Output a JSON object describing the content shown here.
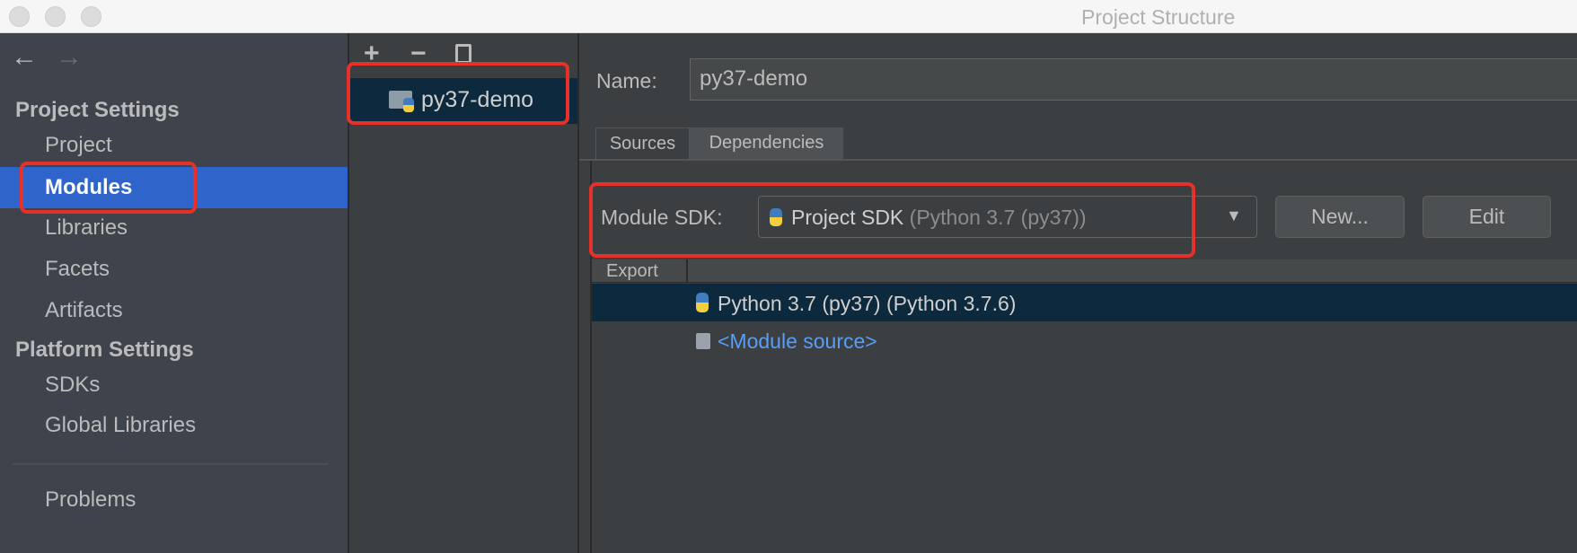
{
  "window": {
    "title": "Project Structure"
  },
  "sidebar": {
    "project_settings": "Project Settings",
    "items": [
      {
        "label": "Project"
      },
      {
        "label": "Modules"
      },
      {
        "label": "Libraries"
      },
      {
        "label": "Facets"
      },
      {
        "label": "Artifacts"
      }
    ],
    "platform_settings": "Platform Settings",
    "platform_items": [
      {
        "label": "SDKs"
      },
      {
        "label": "Global Libraries"
      }
    ],
    "problems": "Problems",
    "selected": "Modules"
  },
  "modules": {
    "items": [
      {
        "label": "py37-demo"
      }
    ]
  },
  "detail": {
    "name_label": "Name:",
    "name_value": "py37-demo",
    "tabs": [
      {
        "label": "Sources"
      },
      {
        "label": "Dependencies"
      }
    ],
    "active_tab": "Dependencies",
    "sdk_label": "Module SDK:",
    "sdk_value": "Project SDK",
    "sdk_detail": "(Python 3.7 (py37))",
    "new_button": "New...",
    "edit_button": "Edit",
    "table": {
      "header": "Export",
      "rows": [
        {
          "label": "Python 3.7 (py37) (Python 3.7.6)"
        },
        {
          "label": "<Module source>"
        }
      ]
    }
  },
  "colors": {
    "selection": "#2f65ca",
    "highlight_box": "#e8302a",
    "link": "#589df6",
    "row_selected": "#0d293e"
  }
}
